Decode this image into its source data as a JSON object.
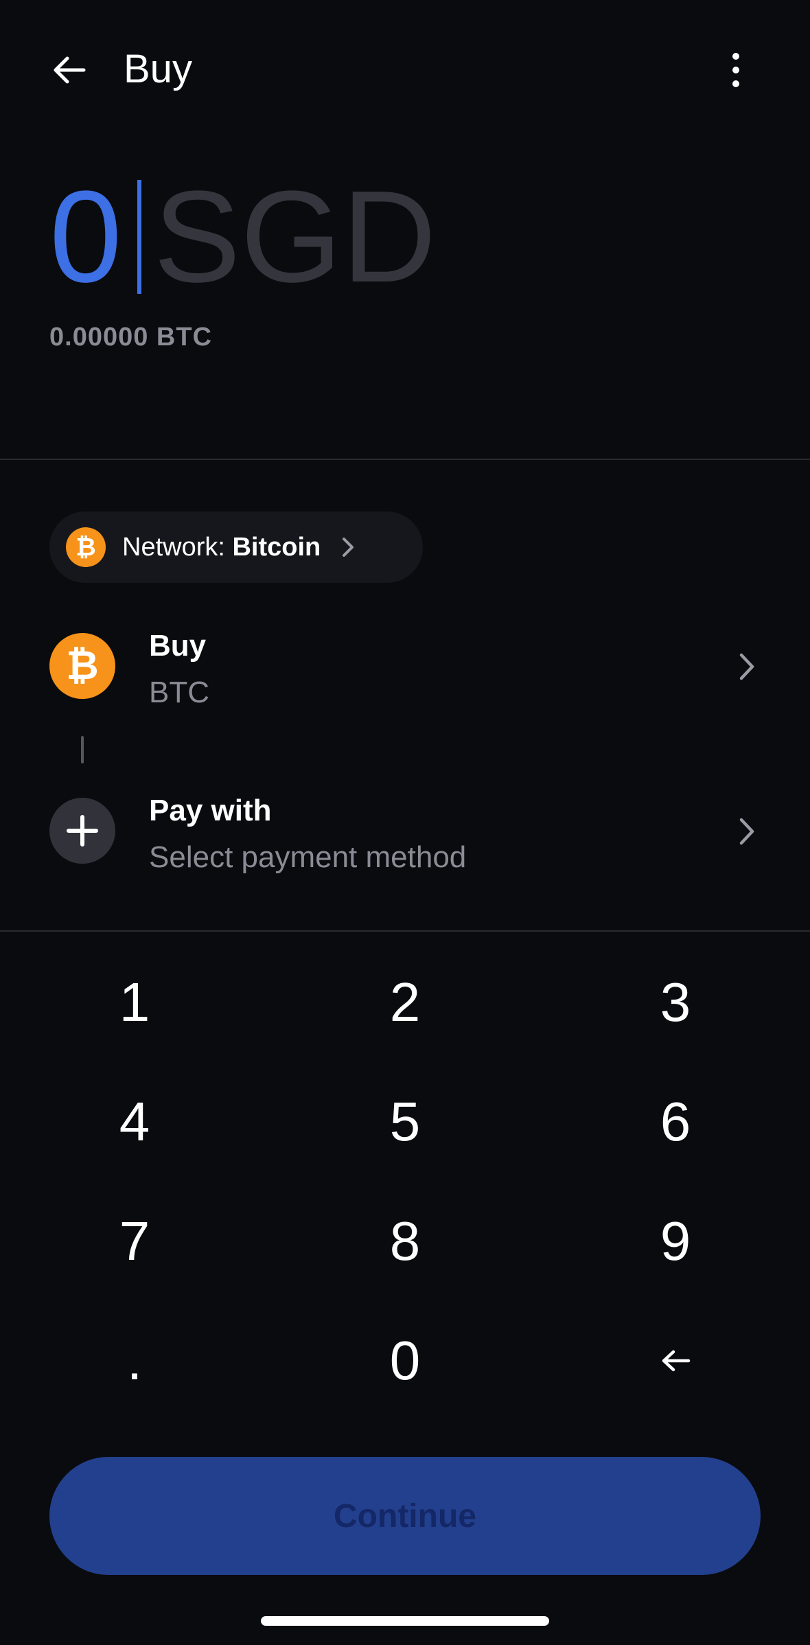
{
  "header": {
    "title": "Buy"
  },
  "amount": {
    "value": "0",
    "currency": "SGD",
    "converted": "0.00000 BTC"
  },
  "network": {
    "label": "Network:",
    "value": "Bitcoin"
  },
  "buy_row": {
    "title": "Buy",
    "subtitle": "BTC"
  },
  "pay_row": {
    "title": "Pay with",
    "subtitle": "Select payment method"
  },
  "keypad": {
    "keys": [
      "1",
      "2",
      "3",
      "4",
      "5",
      "6",
      "7",
      "8",
      "9",
      ".",
      "0"
    ]
  },
  "continue": {
    "label": "Continue"
  },
  "colors": {
    "background": "#0a0b0f",
    "accent": "#3d6fe5",
    "bitcoin": "#f7931a",
    "button_disabled": "#23408e"
  },
  "icons": [
    "arrow-left-icon",
    "more-vertical-icon",
    "bitcoin-icon",
    "chevron-right-icon",
    "plus-icon",
    "backspace-icon"
  ]
}
